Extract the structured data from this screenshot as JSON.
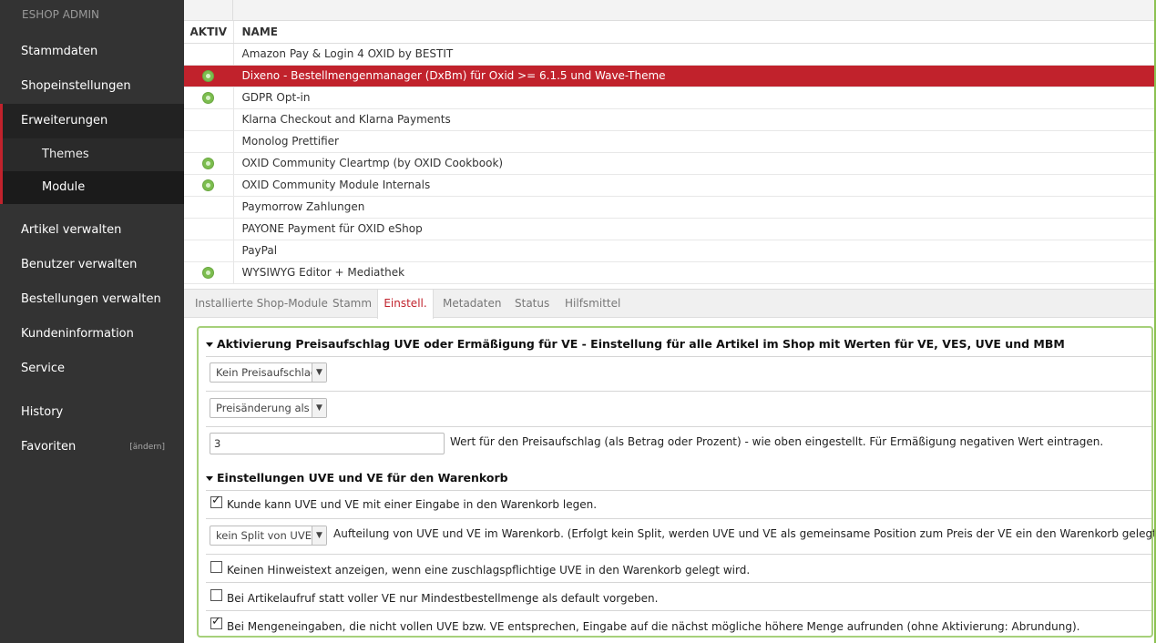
{
  "sidebar": {
    "brand": "ESHOP ADMIN",
    "items": [
      {
        "label": "Stammdaten"
      },
      {
        "label": "Shopeinstellungen"
      },
      {
        "label": "Erweiterungen"
      },
      {
        "label": "Themes"
      },
      {
        "label": "Module"
      },
      {
        "label": "Artikel verwalten"
      },
      {
        "label": "Benutzer verwalten"
      },
      {
        "label": "Bestellungen verwalten"
      },
      {
        "label": "Kundeninformation"
      },
      {
        "label": "Service"
      },
      {
        "label": "History"
      },
      {
        "label": "Favoriten"
      }
    ],
    "favorites_edit": "[ändern]"
  },
  "table": {
    "headers": {
      "active": "AKTIV",
      "name": "NAME"
    },
    "rows": [
      {
        "name": "Amazon Pay & Login 4 OXID by BESTIT",
        "active": false
      },
      {
        "name": "Dixeno - Bestellmengenmanager (DxBm) für Oxid >= 6.1.5 und Wave-Theme",
        "active": true,
        "selected": true
      },
      {
        "name": "GDPR Opt-in",
        "active": true
      },
      {
        "name": "Klarna Checkout and Klarna Payments",
        "active": false
      },
      {
        "name": "Monolog Prettifier",
        "active": false
      },
      {
        "name": "OXID Community Cleartmp (by OXID Cookbook)",
        "active": true
      },
      {
        "name": "OXID Community Module Internals",
        "active": true
      },
      {
        "name": "Paymorrow Zahlungen",
        "active": false
      },
      {
        "name": "PAYONE Payment für OXID eShop",
        "active": false
      },
      {
        "name": "PayPal",
        "active": false
      },
      {
        "name": "WYSIWYG Editor + Mediathek",
        "active": true
      }
    ]
  },
  "tabs": [
    {
      "label": "Installierte Shop-Module"
    },
    {
      "label": "Stamm"
    },
    {
      "label": "Einstell."
    },
    {
      "label": "Metadaten"
    },
    {
      "label": "Status"
    },
    {
      "label": "Hilfsmittel"
    }
  ],
  "settings": {
    "group1_title": "Aktivierung Preisaufschlag UVE oder Ermäßigung für VE - Einstellung für alle Artikel im Shop mit Werten für VE, VES, UVE und MBM",
    "select1_value": "Kein Preisaufschlag",
    "select2_value": "Preisänderung als Betrag",
    "input_value": "3",
    "input_label": "Wert für den Preisaufschlag (als Betrag oder Prozent) - wie oben eingestellt. Für Ermäßigung negativen Wert eintragen.",
    "group2_title": "Einstellungen UVE und VE für den Warenkorb",
    "cb1_label": "Kunde kann UVE und VE mit einer Eingabe in den Warenkorb legen.",
    "cb1_checked": true,
    "select3_value": "kein Split von UVE",
    "select3_label": "Aufteilung von UVE und VE im Warenkorb. (Erfolgt kein Split, werden UVE und VE als gemeinsame Position zum Preis der VE ein den Warenkorb gelegt.)",
    "cb2_label": "Keinen Hinweistext anzeigen, wenn eine zuschlagspflichtige UVE in den Warenkorb gelegt wird.",
    "cb2_checked": false,
    "cb3_label": "Bei Artikelaufruf statt voller VE nur Mindestbestellmenge als default vorgeben.",
    "cb3_checked": false,
    "cb4_label": "Bei Mengeneingaben, die nicht vollen UVE bzw. VE entsprechen, Eingabe auf die nächst mögliche höhere Menge aufrunden (ohne Aktivierung: Abrundung).",
    "cb4_checked": true
  },
  "colors": {
    "accent": "#c1222c",
    "sidebar": "#333333",
    "panel_border": "#a6d07a",
    "active_dot": "#7cbd4f"
  }
}
